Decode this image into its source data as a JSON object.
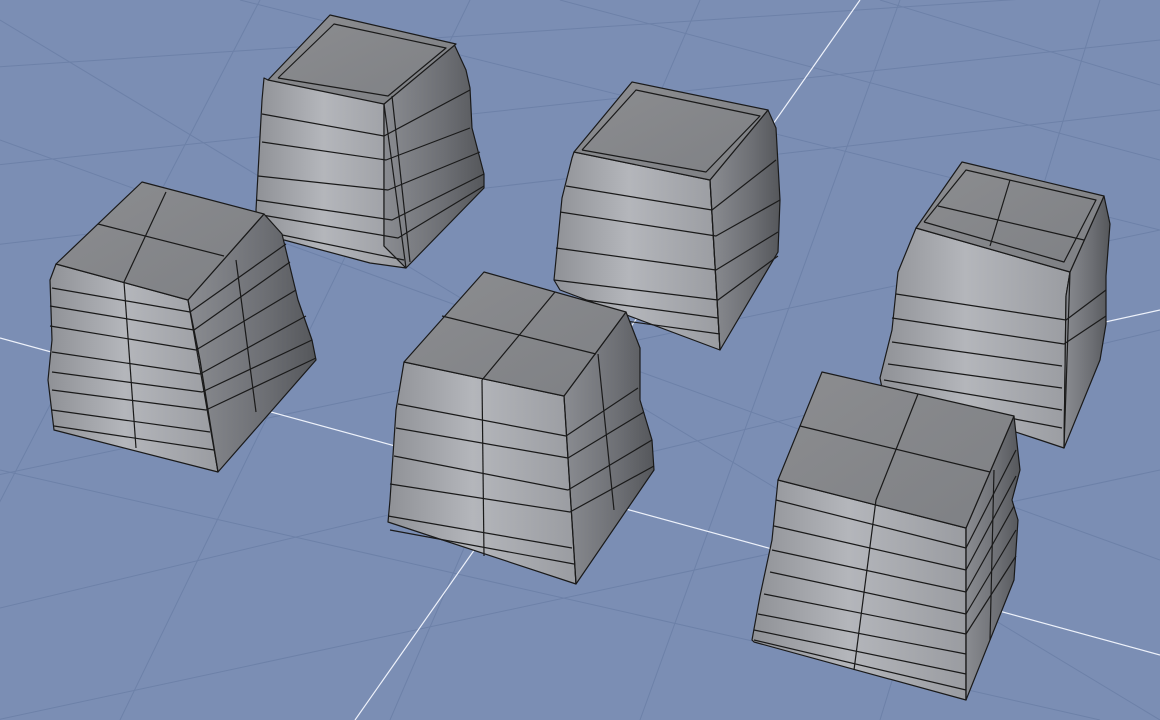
{
  "viewport": {
    "kind": "3d-perspective-viewport",
    "background": "#7b8eb4",
    "grid_color": "#6d81a8",
    "grid_axis_color": "#eef2fb",
    "mesh_edge_color": "#1a1a1a",
    "mesh_face_color": "#a7a9ad"
  },
  "objects": [
    {
      "name": "block-back-left",
      "edge_loops": 6
    },
    {
      "name": "block-back-center",
      "edge_loops": 6
    },
    {
      "name": "block-front-left",
      "edge_loops": 9
    },
    {
      "name": "block-front-center",
      "edge_loops": 8
    },
    {
      "name": "block-right-back",
      "edge_loops": 8
    },
    {
      "name": "block-right-front",
      "edge_loops": 10
    }
  ]
}
